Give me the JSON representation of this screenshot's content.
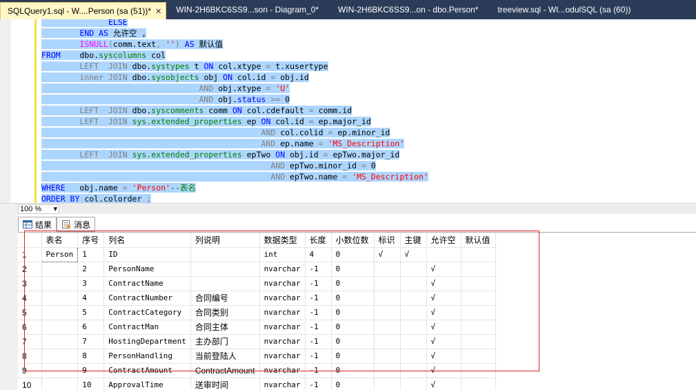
{
  "tabs": [
    {
      "label": "SQLQuery1.sql - W....Person (sa (51))*",
      "active": true
    },
    {
      "label": "WIN-2H6BKC6SS9...son - Diagram_0*",
      "active": false
    },
    {
      "label": "WIN-2H6BKC6SS9...on - dbo.Person*",
      "active": false
    },
    {
      "label": "treeview.sql - WI...odulSQL (sa (60))",
      "active": false
    }
  ],
  "close_glyph": "✕",
  "zoom": {
    "value": "100 %",
    "arrow": "▾"
  },
  "results_tabs": [
    {
      "label": "结果",
      "icon": "grid-icon",
      "active": true
    },
    {
      "label": "消息",
      "icon": "message-icon",
      "active": false
    }
  ],
  "grid": {
    "headers": [
      "表名",
      "序号",
      "列名",
      "列说明",
      "数据类型",
      "长度",
      "小数位数",
      "标识",
      "主键",
      "允许空",
      "默认值"
    ],
    "rows": [
      {
        "rn": "1",
        "cells": [
          "Person",
          "1",
          "ID",
          "",
          "int",
          "4",
          "0",
          "√",
          "√",
          "",
          ""
        ]
      },
      {
        "rn": "2",
        "cells": [
          "",
          "2",
          "PersonName",
          "",
          "nvarchar",
          "-1",
          "0",
          "",
          "",
          "√",
          ""
        ]
      },
      {
        "rn": "3",
        "cells": [
          "",
          "3",
          "ContractName",
          "",
          "nvarchar",
          "-1",
          "0",
          "",
          "",
          "√",
          ""
        ]
      },
      {
        "rn": "4",
        "cells": [
          "",
          "4",
          "ContractNumber",
          "合同编号",
          "nvarchar",
          "-1",
          "0",
          "",
          "",
          "√",
          ""
        ]
      },
      {
        "rn": "5",
        "cells": [
          "",
          "5",
          "ContractCategory",
          "合同类别",
          "nvarchar",
          "-1",
          "0",
          "",
          "",
          "√",
          ""
        ]
      },
      {
        "rn": "6",
        "cells": [
          "",
          "6",
          "ContractMan",
          "合同主体",
          "nvarchar",
          "-1",
          "0",
          "",
          "",
          "√",
          ""
        ]
      },
      {
        "rn": "7",
        "cells": [
          "",
          "7",
          "HostingDepartment",
          "主办部门",
          "nvarchar",
          "-1",
          "0",
          "",
          "",
          "√",
          ""
        ]
      },
      {
        "rn": "8",
        "cells": [
          "",
          "8",
          "PersonHandling",
          "当前登陆人",
          "nvarchar",
          "-1",
          "0",
          "",
          "",
          "√",
          ""
        ]
      },
      {
        "rn": "9",
        "cells": [
          "",
          "9",
          "ContractAmount",
          "ContractAmount",
          "nvarchar",
          "-1",
          "0",
          "",
          "",
          "√",
          ""
        ]
      },
      {
        "rn": "10",
        "cells": [
          "",
          "10",
          "ApprovalTime",
          "送审时间",
          "nvarchar",
          "-1",
          "0",
          "",
          "",
          "√",
          ""
        ]
      }
    ]
  },
  "code_lines": [
    [
      {
        "t": "              "
      },
      {
        "t": "ELSE",
        "c": "kw"
      }
    ],
    [
      {
        "t": "        "
      },
      {
        "t": "END AS",
        "c": "kw"
      },
      {
        "t": " 允许空 ,"
      }
    ],
    [
      {
        "t": "        "
      },
      {
        "t": "ISNULL",
        "c": "fn"
      },
      {
        "t": "(",
        "c": "gr"
      },
      {
        "t": "comm.text"
      },
      {
        "t": ",",
        "c": "gr"
      },
      {
        "t": " "
      },
      {
        "t": "''",
        "c": "st"
      },
      {
        "t": ")",
        "c": "gr"
      },
      {
        "t": " "
      },
      {
        "t": "AS",
        "c": "kw"
      },
      {
        "t": " 默认值"
      }
    ],
    [
      {
        "t": "FROM",
        "c": "kw"
      },
      {
        "t": "    dbo."
      },
      {
        "t": "syscolumns",
        "c": "tb"
      },
      {
        "t": " col"
      }
    ],
    [
      {
        "t": "        "
      },
      {
        "t": "LEFT  JOIN",
        "c": "gr"
      },
      {
        "t": " dbo."
      },
      {
        "t": "systypes",
        "c": "tb"
      },
      {
        "t": " t "
      },
      {
        "t": "ON",
        "c": "kw"
      },
      {
        "t": " col.xtype "
      },
      {
        "t": "=",
        "c": "gr"
      },
      {
        "t": " t.xusertype"
      }
    ],
    [
      {
        "t": "        "
      },
      {
        "t": "inner JOIN",
        "c": "gr"
      },
      {
        "t": " dbo."
      },
      {
        "t": "sysobjects",
        "c": "tb"
      },
      {
        "t": " obj "
      },
      {
        "t": "ON",
        "c": "kw"
      },
      {
        "t": " col.id "
      },
      {
        "t": "=",
        "c": "gr"
      },
      {
        "t": " obj.id"
      }
    ],
    [
      {
        "t": "                                 "
      },
      {
        "t": "AND",
        "c": "gr"
      },
      {
        "t": " obj.xtype "
      },
      {
        "t": "=",
        "c": "gr"
      },
      {
        "t": " "
      },
      {
        "t": "'U'",
        "c": "st"
      }
    ],
    [
      {
        "t": "                                 "
      },
      {
        "t": "AND",
        "c": "gr"
      },
      {
        "t": " obj."
      },
      {
        "t": "status",
        "c": "kw"
      },
      {
        "t": " "
      },
      {
        "t": ">=",
        "c": "gr"
      },
      {
        "t": " 0"
      }
    ],
    [
      {
        "t": "        "
      },
      {
        "t": "LEFT  JOIN",
        "c": "gr"
      },
      {
        "t": " dbo."
      },
      {
        "t": "syscomments",
        "c": "tb"
      },
      {
        "t": " comm "
      },
      {
        "t": "ON",
        "c": "kw"
      },
      {
        "t": " col.cdefault "
      },
      {
        "t": "=",
        "c": "gr"
      },
      {
        "t": " comm.id"
      }
    ],
    [
      {
        "t": "        "
      },
      {
        "t": "LEFT  JOIN",
        "c": "gr"
      },
      {
        "t": " "
      },
      {
        "t": "sys.extended_properties",
        "c": "tb"
      },
      {
        "t": " ep "
      },
      {
        "t": "ON",
        "c": "kw"
      },
      {
        "t": " col.id "
      },
      {
        "t": "=",
        "c": "gr"
      },
      {
        "t": " ep.major_id"
      }
    ],
    [
      {
        "t": "                                              "
      },
      {
        "t": "AND",
        "c": "gr"
      },
      {
        "t": " col.colid "
      },
      {
        "t": "=",
        "c": "gr"
      },
      {
        "t": " ep.minor_id"
      }
    ],
    [
      {
        "t": "                                              "
      },
      {
        "t": "AND",
        "c": "gr"
      },
      {
        "t": " ep.name "
      },
      {
        "t": "=",
        "c": "gr"
      },
      {
        "t": " "
      },
      {
        "t": "'MS_Description'",
        "c": "st"
      }
    ],
    [
      {
        "t": "        "
      },
      {
        "t": "LEFT  JOIN",
        "c": "gr"
      },
      {
        "t": " "
      },
      {
        "t": "sys.extended_properties",
        "c": "tb"
      },
      {
        "t": " epTwo "
      },
      {
        "t": "ON",
        "c": "kw"
      },
      {
        "t": " obj.id "
      },
      {
        "t": "=",
        "c": "gr"
      },
      {
        "t": " epTwo.major_id"
      }
    ],
    [
      {
        "t": "                                                "
      },
      {
        "t": "AND",
        "c": "gr"
      },
      {
        "t": " epTwo.minor_id "
      },
      {
        "t": "=",
        "c": "gr"
      },
      {
        "t": " 0"
      }
    ],
    [
      {
        "t": "                                                "
      },
      {
        "t": "AND",
        "c": "gr"
      },
      {
        "t": " epTwo.name "
      },
      {
        "t": "=",
        "c": "gr"
      },
      {
        "t": " "
      },
      {
        "t": "'MS_Description'",
        "c": "st"
      }
    ],
    [
      {
        "t": "WHERE",
        "c": "kw"
      },
      {
        "t": "   obj.name "
      },
      {
        "t": "=",
        "c": "gr"
      },
      {
        "t": " "
      },
      {
        "t": "'Person'",
        "c": "st"
      },
      {
        "t": "--表名",
        "c": "cm"
      }
    ],
    [
      {
        "t": "ORDER BY",
        "c": "kw"
      },
      {
        "t": " col.colorder "
      },
      {
        "t": ";",
        "c": "gr"
      }
    ]
  ]
}
